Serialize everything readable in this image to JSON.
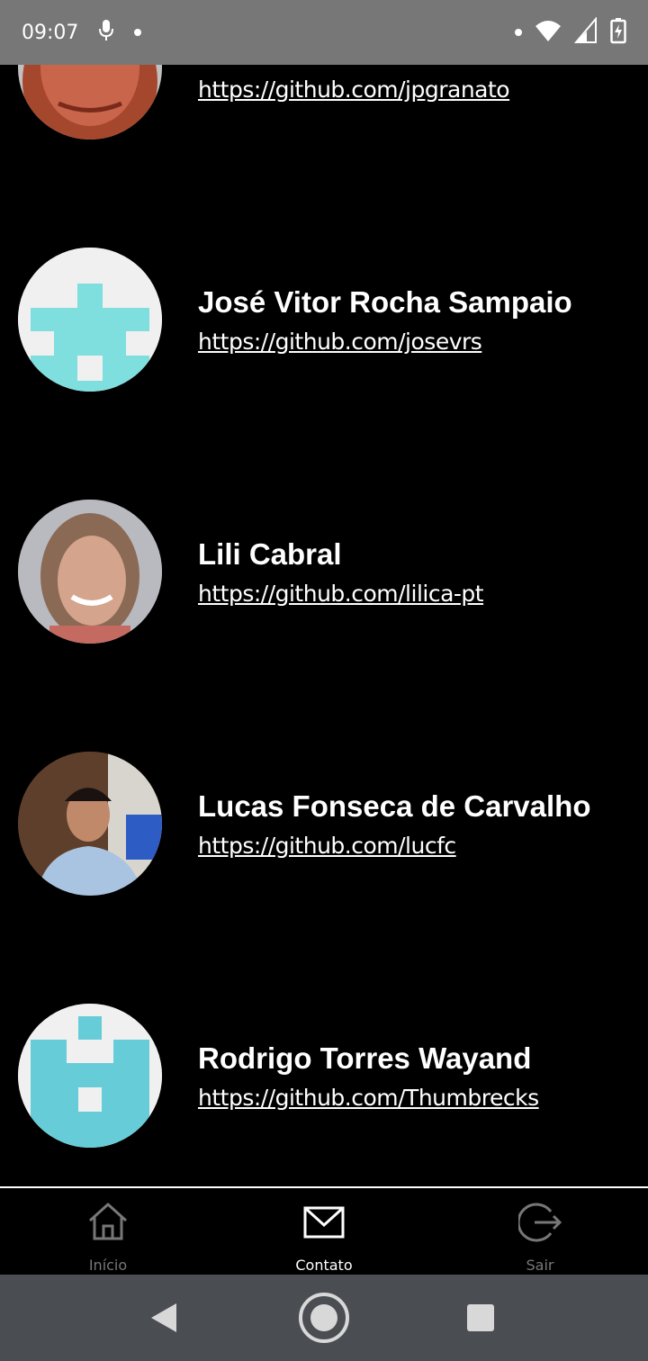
{
  "status_bar": {
    "time": "09:07",
    "icons": [
      "mic-icon",
      "notification-dot",
      "wifi-icon",
      "signal-icon",
      "battery-charging-icon"
    ]
  },
  "contacts": [
    {
      "name": "",
      "url": "https://github.com/jpgranato",
      "avatar": "photo-man-glasses"
    },
    {
      "name": "José Vitor Rocha Sampaio",
      "url": "https://github.com/josevrs",
      "avatar": "identicon-cyan"
    },
    {
      "name": "Lili Cabral",
      "url": "https://github.com/lilica-pt",
      "avatar": "photo-woman"
    },
    {
      "name": "Lucas Fonseca de Carvalho",
      "url": "https://github.com/lucfc",
      "avatar": "photo-man-shirt"
    },
    {
      "name": "Rodrigo Torres Wayand",
      "url": "https://github.com/Thumbrecks",
      "avatar": "identicon-cyan"
    }
  ],
  "bottom_nav": {
    "items": [
      {
        "label": "Início",
        "icon": "home-icon",
        "active": false
      },
      {
        "label": "Contato",
        "icon": "mail-icon",
        "active": true
      },
      {
        "label": "Sair",
        "icon": "logout-icon",
        "active": false
      }
    ]
  },
  "colors": {
    "background": "#000000",
    "status_bar": "#777777",
    "identicon": "#7fdede",
    "nav_inactive": "#777777",
    "nav_active": "#ffffff",
    "system_nav": "#4a4d52"
  },
  "system_nav": {
    "buttons": [
      "back-button",
      "home-button",
      "recents-button"
    ]
  }
}
